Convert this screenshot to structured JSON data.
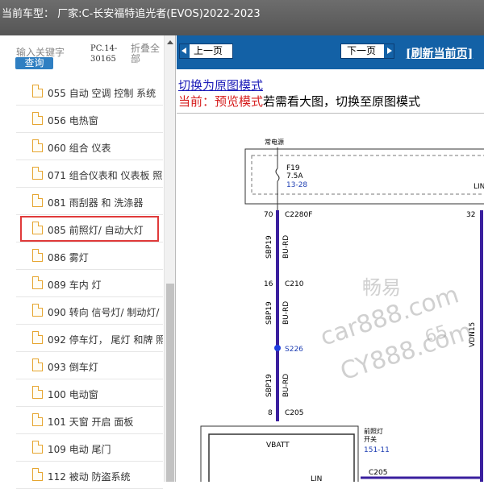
{
  "window": {
    "title": "当前车型：  厂家:C-长安福特追光者(EVOS)2022-2023"
  },
  "search": {
    "keyword_label": "输入关键字",
    "query_button": "查询",
    "code": "PC.14-30165",
    "collapse_all": "折叠全部"
  },
  "tree": {
    "items": [
      {
        "label": "055 自动 空调 控制 系统",
        "selected": false
      },
      {
        "label": "056 电热窗",
        "selected": false
      },
      {
        "label": "060 组合 仪表",
        "selected": false
      },
      {
        "label": "071 组合仪表和 仪表板 照",
        "selected": false
      },
      {
        "label": "081 雨刮器 和 洗涤器",
        "selected": false
      },
      {
        "label": "085 前照灯/ 自动大灯",
        "selected": true
      },
      {
        "label": "086 雾灯",
        "selected": false
      },
      {
        "label": "089 车内 灯",
        "selected": false
      },
      {
        "label": "090 转向 信号灯/ 制动灯/",
        "selected": false
      },
      {
        "label": "092 停车灯， 尾灯 和牌 照",
        "selected": false
      },
      {
        "label": "093 倒车灯",
        "selected": false
      },
      {
        "label": "100 电动窗",
        "selected": false
      },
      {
        "label": "101 天窗 开启 面板",
        "selected": false
      },
      {
        "label": "109 电动 尾门",
        "selected": false
      },
      {
        "label": "112 被动 防盗系统",
        "selected": false
      }
    ]
  },
  "toolbar": {
    "prev_label": "上一页",
    "next_label": "下一页",
    "refresh_label": "[刷新当前页]"
  },
  "view": {
    "switch_link": "切换为原图模式",
    "current_prefix": "当前：预览模式",
    "current_suffix": "若需看大图，切换至原图模式"
  },
  "diagram": {
    "power_label": "常电源",
    "fuse_name": "F19",
    "fuse_rating": "7.5A",
    "fuse_ref": "13-28",
    "lin_label": "LIN",
    "pin_70": "70",
    "conn_c2280f": "C2280F",
    "pin_32": "32",
    "circuit": "SBP19",
    "wire_color": "BU-RD",
    "pin_16": "16",
    "conn_c210": "C210",
    "splice": "S226",
    "pin_8": "8",
    "conn_c205": "C205",
    "vbatt": "VBATT",
    "switch_label": "前照灯\n开关",
    "switch_ref": "151-11",
    "conn_c205_b": "C205",
    "lin_bottom": "LIN",
    "vdn": "VDN15"
  },
  "watermark": {
    "cn": "畅易",
    "line1": "car888.com",
    "line2": "CY888.com",
    "digits": "65"
  },
  "colors": {
    "toolbar": "#1361a6",
    "wire": "#3a1f9e",
    "highlight": "#e03a3a",
    "link": "#1b1bb8",
    "red_text": "#d61f1f"
  }
}
